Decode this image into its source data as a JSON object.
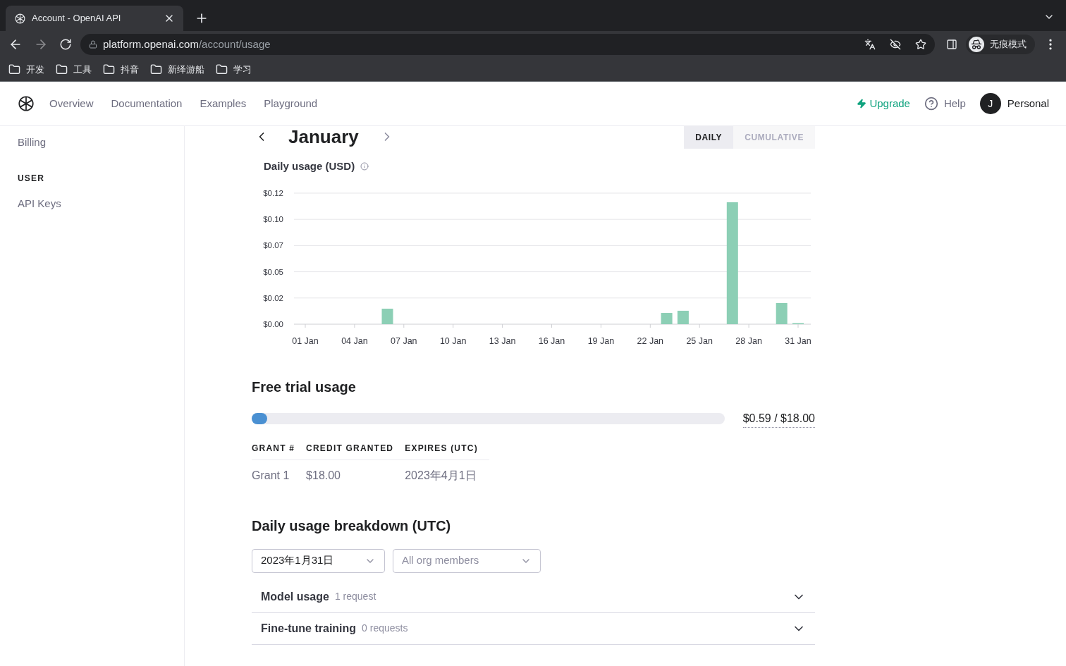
{
  "browser": {
    "tab_title": "Account - OpenAI API",
    "url_host": "platform.openai.com",
    "url_path": "/account/usage",
    "bookmarks": [
      "开发",
      "工具",
      "抖音",
      "新绎游船",
      "学习"
    ],
    "profile": "无痕模式"
  },
  "nav": {
    "items": [
      "Overview",
      "Documentation",
      "Examples",
      "Playground"
    ],
    "upgrade": "Upgrade",
    "help": "Help",
    "avatar": "J",
    "account": "Personal"
  },
  "sidebar": [
    {
      "kind": "link",
      "label": "Billing"
    },
    {
      "kind": "heading",
      "label": "USER"
    },
    {
      "kind": "link",
      "label": "API Keys"
    }
  ],
  "month": "January",
  "view_toggle": [
    {
      "label": "DAILY",
      "selected": true
    },
    {
      "label": "CUMULATIVE",
      "selected": false
    }
  ],
  "usage_chart": {
    "title": "Daily usage (USD)",
    "chart_data": {
      "type": "bar",
      "categories": [
        "01 Jan",
        null,
        null,
        "04 Jan",
        null,
        null,
        "07 Jan",
        null,
        null,
        "10 Jan",
        null,
        null,
        "13 Jan",
        null,
        null,
        "16 Jan",
        null,
        null,
        "19 Jan",
        null,
        null,
        "22 Jan",
        null,
        null,
        "25 Jan",
        null,
        null,
        "28 Jan",
        null,
        null,
        "31 Jan"
      ],
      "grid": true,
      "values": [
        0,
        0,
        0,
        0,
        0,
        0.0142,
        0,
        0,
        0,
        0,
        0,
        0,
        0,
        0,
        0,
        0,
        0,
        0,
        0,
        0,
        0,
        0,
        0.0103,
        0.0123,
        0,
        0,
        0.1116,
        0,
        0,
        0.0194,
        0.001
      ],
      "ylim": [
        0,
        0.12
      ],
      "yticks": [
        {
          "value": 0,
          "label": "$0.00"
        },
        {
          "value": 0.024,
          "label": "$0.02"
        },
        {
          "value": 0.048,
          "label": "$0.05"
        },
        {
          "value": 0.072,
          "label": "$0.07"
        },
        {
          "value": 0.096,
          "label": "$0.10"
        },
        {
          "value": 0.12,
          "label": "$0.12"
        }
      ],
      "color": "#8ccfb5"
    }
  },
  "free_trial": {
    "title": "Free trial usage",
    "level": 0.033,
    "reading": "$0.59 / $18.00"
  },
  "grants": {
    "columns": [
      "GRANT #",
      "CREDIT GRANTED",
      "EXPIRES (UTC)"
    ],
    "rows": [
      [
        "Grant 1",
        "$18.00",
        "2023年4月1日"
      ]
    ]
  },
  "breakdown": {
    "title": "Daily usage breakdown (UTC)",
    "date_value": "2023年1月31日",
    "members_placeholder": "All org members",
    "sections": [
      {
        "title": "Model usage",
        "count": "1 request",
        "expanded": false
      },
      {
        "title": "Fine-tune training",
        "count": "0 requests",
        "expanded": false
      }
    ]
  }
}
